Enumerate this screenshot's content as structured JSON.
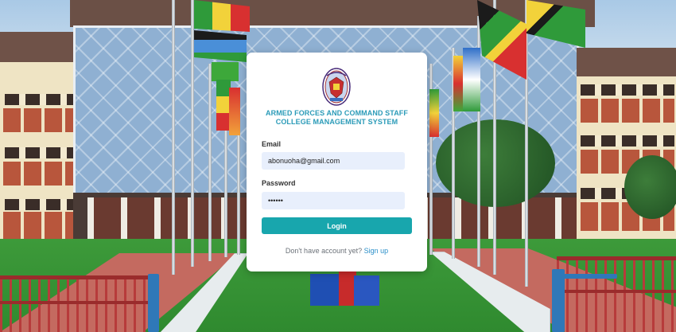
{
  "app": {
    "title_line1": "ARMED FORCES AND COMMAND STAFF",
    "title_line2": "COLLEGE MANAGEMENT SYSTEM",
    "logo_icon": "college-crest-icon"
  },
  "form": {
    "email_label": "Email",
    "email_value": "abonuoha@gmail.com",
    "password_label": "Password",
    "password_value": "••••••",
    "login_label": "Login"
  },
  "footer": {
    "prompt": "Don't have account yet?",
    "signup_label": "Sign up"
  },
  "colors": {
    "accent": "#18a6ad",
    "title": "#2b9bb8",
    "link": "#2a8fc9",
    "input_bg": "#e8effc"
  }
}
